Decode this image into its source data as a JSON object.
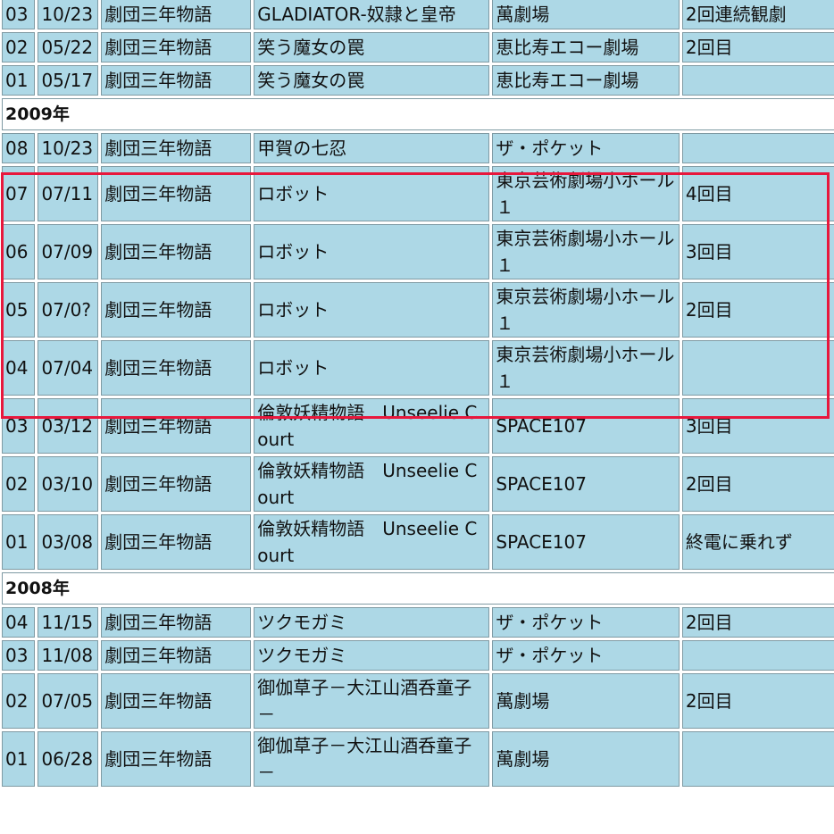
{
  "sections": [
    {
      "year": "",
      "rows": [
        {
          "no": "03",
          "date": "10/23",
          "troupe": "劇団三年物語",
          "title": "GLADIATOR-奴隷と皇帝",
          "venue": "萬劇場",
          "note": "2回連続観劇"
        },
        {
          "no": "02",
          "date": "05/22",
          "troupe": "劇団三年物語",
          "title": "笑う魔女の罠",
          "venue": "恵比寿エコー劇場",
          "note": "2回目"
        },
        {
          "no": "01",
          "date": "05/17",
          "troupe": "劇団三年物語",
          "title": "笑う魔女の罠",
          "venue": "恵比寿エコー劇場",
          "note": ""
        }
      ]
    },
    {
      "year": "2009年",
      "rows": [
        {
          "no": "08",
          "date": "10/23",
          "troupe": "劇団三年物語",
          "title": "甲賀の七忍",
          "venue": "ザ・ポケット",
          "note": ""
        },
        {
          "no": "07",
          "date": "07/11",
          "troupe": "劇団三年物語",
          "title": "ロボット",
          "venue": "東京芸術劇場小ホール１",
          "note": "4回目"
        },
        {
          "no": "06",
          "date": "07/09",
          "troupe": "劇団三年物語",
          "title": "ロボット",
          "venue": "東京芸術劇場小ホール１",
          "note": "3回目"
        },
        {
          "no": "05",
          "date": "07/0?",
          "troupe": "劇団三年物語",
          "title": "ロボット",
          "venue": "東京芸術劇場小ホール１",
          "note": "2回目"
        },
        {
          "no": "04",
          "date": "07/04",
          "troupe": "劇団三年物語",
          "title": "ロボット",
          "venue": "東京芸術劇場小ホール１",
          "note": ""
        },
        {
          "no": "03",
          "date": "03/12",
          "troupe": "劇団三年物語",
          "title": "倫敦妖精物語　Unseelie Court",
          "venue": "SPACE107",
          "note": "3回目"
        },
        {
          "no": "02",
          "date": "03/10",
          "troupe": "劇団三年物語",
          "title": "倫敦妖精物語　Unseelie Court",
          "venue": "SPACE107",
          "note": "2回目"
        },
        {
          "no": "01",
          "date": "03/08",
          "troupe": "劇団三年物語",
          "title": "倫敦妖精物語　Unseelie Court",
          "venue": "SPACE107",
          "note": "終電に乗れず"
        }
      ]
    },
    {
      "year": "2008年",
      "rows": [
        {
          "no": "04",
          "date": "11/15",
          "troupe": "劇団三年物語",
          "title": "ツクモガミ",
          "venue": "ザ・ポケット",
          "note": "2回目"
        },
        {
          "no": "03",
          "date": "11/08",
          "troupe": "劇団三年物語",
          "title": "ツクモガミ",
          "venue": "ザ・ポケット",
          "note": ""
        },
        {
          "no": "02",
          "date": "07/05",
          "troupe": "劇団三年物語",
          "title": "御伽草子－大江山酒呑童子－",
          "venue": "萬劇場",
          "note": "2回目"
        },
        {
          "no": "01",
          "date": "06/28",
          "troupe": "劇団三年物語",
          "title": "御伽草子－大江山酒呑童子－",
          "venue": "萬劇場",
          "note": ""
        }
      ]
    }
  ],
  "colors": {
    "cell_bg": "#add8e6",
    "highlight": "#e8173c"
  }
}
